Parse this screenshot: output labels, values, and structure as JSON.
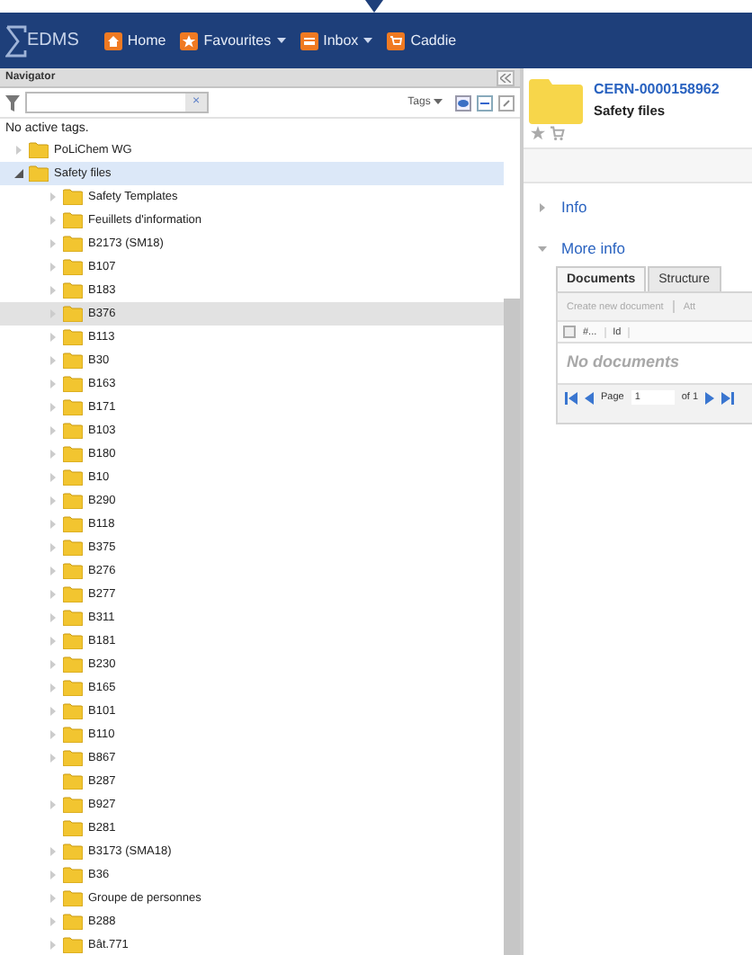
{
  "header": {
    "logo": "EDMS",
    "menu": [
      {
        "label": "Home",
        "dropdown": false
      },
      {
        "label": "Favourites",
        "dropdown": true
      },
      {
        "label": "Inbox",
        "dropdown": true
      },
      {
        "label": "Caddie",
        "dropdown": false
      }
    ]
  },
  "navigator": {
    "title": "Navigator",
    "search": {
      "clear": "×"
    },
    "tags_button": "Tags",
    "tags_status": "No active tags.",
    "tree": [
      {
        "label": "PoLiChem WG",
        "expandable": true,
        "expanded": false,
        "selected": false,
        "hovered": false
      },
      {
        "label": "Safety files",
        "expandable": true,
        "expanded": true,
        "selected": true,
        "hovered": false,
        "children": [
          {
            "label": "Safety Templates",
            "expandable": true,
            "hovered": false
          },
          {
            "label": "Feuillets d'information",
            "expandable": true,
            "hovered": false
          },
          {
            "label": "B2173 (SM18)",
            "expandable": true,
            "hovered": false
          },
          {
            "label": "B107",
            "expandable": true,
            "hovered": false
          },
          {
            "label": "B183",
            "expandable": true,
            "hovered": false
          },
          {
            "label": "B376",
            "expandable": true,
            "hovered": true
          },
          {
            "label": "B113",
            "expandable": true,
            "hovered": false
          },
          {
            "label": "B30",
            "expandable": true,
            "hovered": false
          },
          {
            "label": "B163",
            "expandable": true,
            "hovered": false
          },
          {
            "label": "B171",
            "expandable": true,
            "hovered": false
          },
          {
            "label": "B103",
            "expandable": true,
            "hovered": false
          },
          {
            "label": "B180",
            "expandable": true,
            "hovered": false
          },
          {
            "label": "B10",
            "expandable": true,
            "hovered": false
          },
          {
            "label": "B290",
            "expandable": true,
            "hovered": false
          },
          {
            "label": "B118",
            "expandable": true,
            "hovered": false
          },
          {
            "label": "B375",
            "expandable": true,
            "hovered": false
          },
          {
            "label": "B276",
            "expandable": true,
            "hovered": false
          },
          {
            "label": "B277",
            "expandable": true,
            "hovered": false
          },
          {
            "label": "B311",
            "expandable": true,
            "hovered": false
          },
          {
            "label": "B181",
            "expandable": true,
            "hovered": false
          },
          {
            "label": "B230",
            "expandable": true,
            "hovered": false
          },
          {
            "label": "B165",
            "expandable": true,
            "hovered": false
          },
          {
            "label": "B101",
            "expandable": true,
            "hovered": false
          },
          {
            "label": "B110",
            "expandable": true,
            "hovered": false
          },
          {
            "label": "B867",
            "expandable": true,
            "hovered": false
          },
          {
            "label": "B287",
            "expandable": false,
            "hovered": false
          },
          {
            "label": "B927",
            "expandable": true,
            "hovered": false
          },
          {
            "label": "B281",
            "expandable": false,
            "hovered": false
          },
          {
            "label": "B3173 (SMA18)",
            "expandable": true,
            "hovered": false
          },
          {
            "label": "B36",
            "expandable": true,
            "hovered": false
          },
          {
            "label": "Groupe de personnes",
            "expandable": true,
            "hovered": false
          },
          {
            "label": "B288",
            "expandable": true,
            "hovered": false
          },
          {
            "label": "Bât.771",
            "expandable": true,
            "hovered": false
          }
        ]
      }
    ]
  },
  "detail": {
    "id": "CERN-0000158962",
    "title": "Safety files",
    "sections": [
      {
        "label": "Info",
        "expanded": false
      },
      {
        "label": "More info",
        "expanded": true
      }
    ],
    "tabs": [
      {
        "label": "Documents",
        "selected": true
      },
      {
        "label": "Structure",
        "selected": false
      }
    ],
    "toolbar": [
      "Create new document",
      "Att"
    ],
    "select_all": {
      "checked": false
    },
    "columns": [
      "#...",
      "Id"
    ],
    "empty": "No documents",
    "paging": {
      "page_label": "Page",
      "page": "1",
      "of": "of 1"
    }
  }
}
